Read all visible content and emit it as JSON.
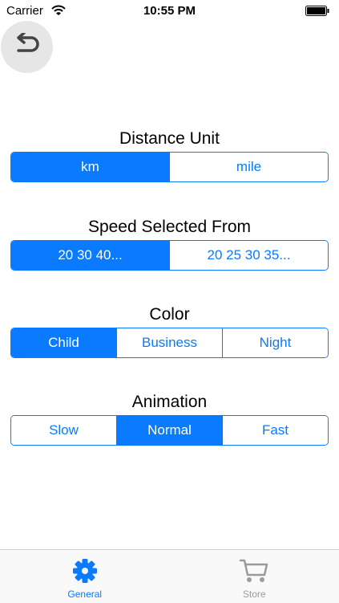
{
  "status_bar": {
    "carrier": "Carrier",
    "time": "10:55 PM"
  },
  "back_button": {
    "icon": "undo-arrow-icon"
  },
  "settings": [
    {
      "title": "Distance Unit",
      "options": [
        "km",
        "mile"
      ],
      "selected": 0
    },
    {
      "title": "Speed Selected From",
      "options": [
        "20 30 40...",
        "20 25 30 35..."
      ],
      "selected": 0
    },
    {
      "title": "Color",
      "options": [
        "Child",
        "Business",
        "Night"
      ],
      "selected": 0
    },
    {
      "title": "Animation",
      "options": [
        "Slow",
        "Normal",
        "Fast"
      ],
      "selected": 1
    }
  ],
  "tab_bar": {
    "tabs": [
      {
        "label": "General",
        "icon": "gear-icon",
        "active": true
      },
      {
        "label": "Store",
        "icon": "cart-icon",
        "active": false
      }
    ]
  },
  "colors": {
    "accent": "#0a7aff",
    "inactive": "#9a9a9a"
  }
}
